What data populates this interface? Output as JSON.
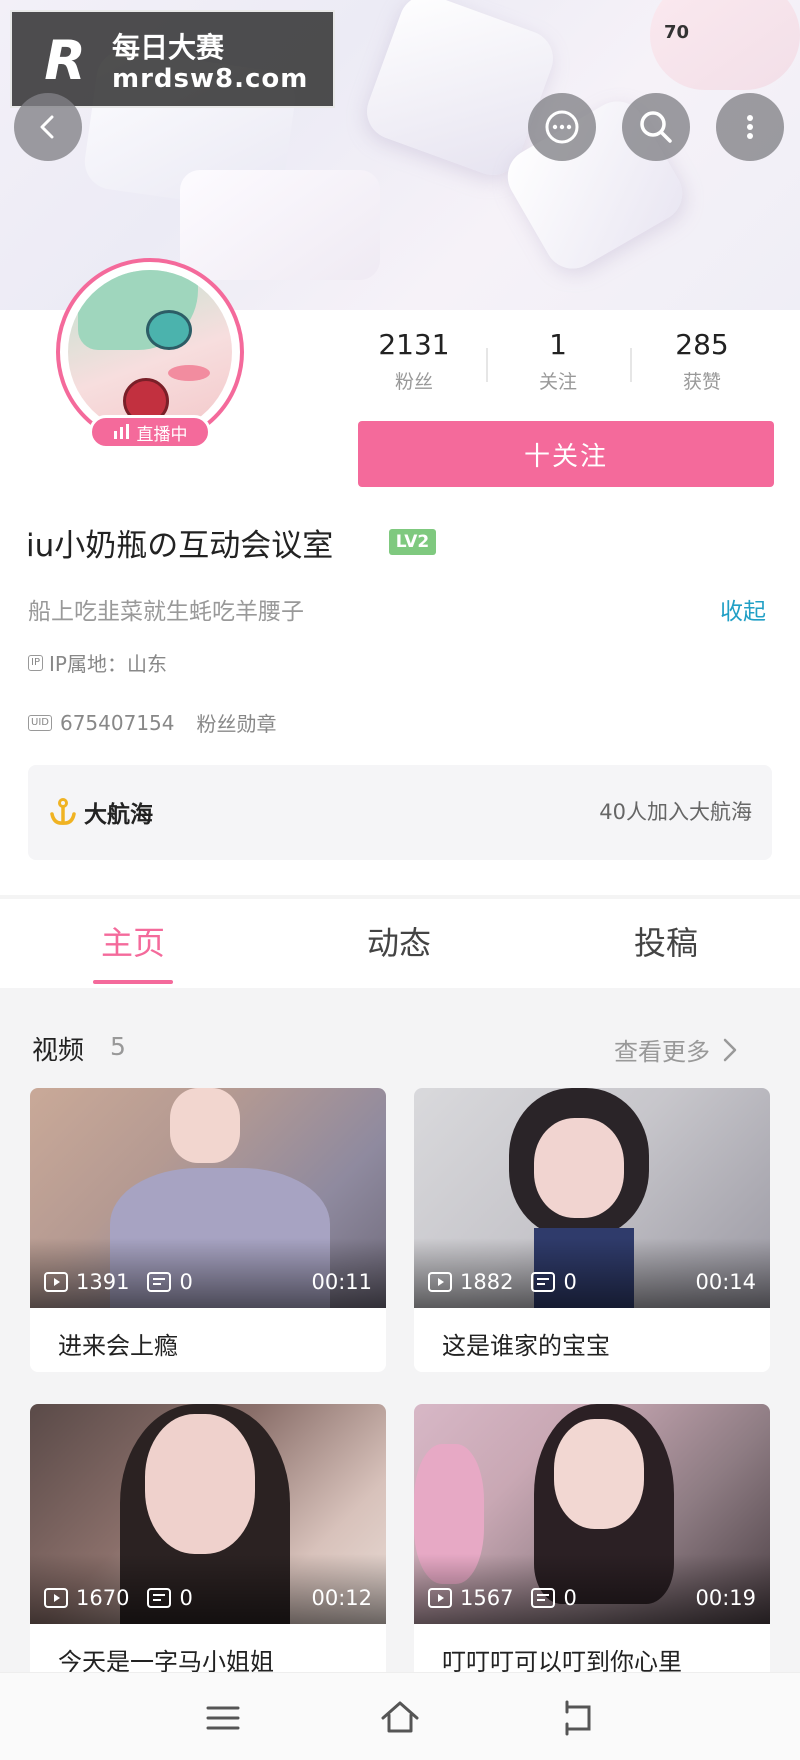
{
  "watermark": {
    "title": "每日大赛",
    "url": "mrdsw8.com",
    "logo": "R"
  },
  "status": {
    "number": "70"
  },
  "profile": {
    "live_badge": "直播中",
    "stats": [
      {
        "value": "2131",
        "label": "粉丝"
      },
      {
        "value": "1",
        "label": "关注"
      },
      {
        "value": "285",
        "label": "获赞"
      }
    ],
    "follow_button": "十关注",
    "name": "iu小奶瓶の互动会议室",
    "level": "LV2",
    "signature": "船上吃韭菜就生蚝吃羊腰子",
    "collapse_label": "收起",
    "ip_tag": "IP",
    "ip": "IP属地：山东",
    "uid_tag": "UID",
    "uid": "675407154",
    "fan_medal": "粉丝勋章"
  },
  "guard": {
    "label": "大航海",
    "count": "40人加入大航海"
  },
  "tabs": [
    {
      "label": "主页"
    },
    {
      "label": "动态"
    },
    {
      "label": "投稿"
    }
  ],
  "videos_section": {
    "title": "视频",
    "count": "5",
    "more": "查看更多",
    "items": [
      {
        "plays": "1391",
        "comments": "0",
        "duration": "00:11",
        "title": "进来会上瘾"
      },
      {
        "plays": "1882",
        "comments": "0",
        "duration": "00:14",
        "title": "这是谁家的宝宝"
      },
      {
        "plays": "1670",
        "comments": "0",
        "duration": "00:12",
        "title": "今天是一字马小姐姐"
      },
      {
        "plays": "1567",
        "comments": "0",
        "duration": "00:19",
        "title": "叮叮叮可以叮到你心里"
      }
    ]
  },
  "colors": {
    "accent": "#f46a9b",
    "link": "#22a0c6",
    "level": "#7fc97f"
  },
  "icons": [
    "back-icon",
    "message-icon",
    "search-icon",
    "more-vertical-icon",
    "anchor-icon",
    "play-icon",
    "comment-icon",
    "chevron-right-icon",
    "menu-icon",
    "home-icon",
    "return-icon"
  ]
}
